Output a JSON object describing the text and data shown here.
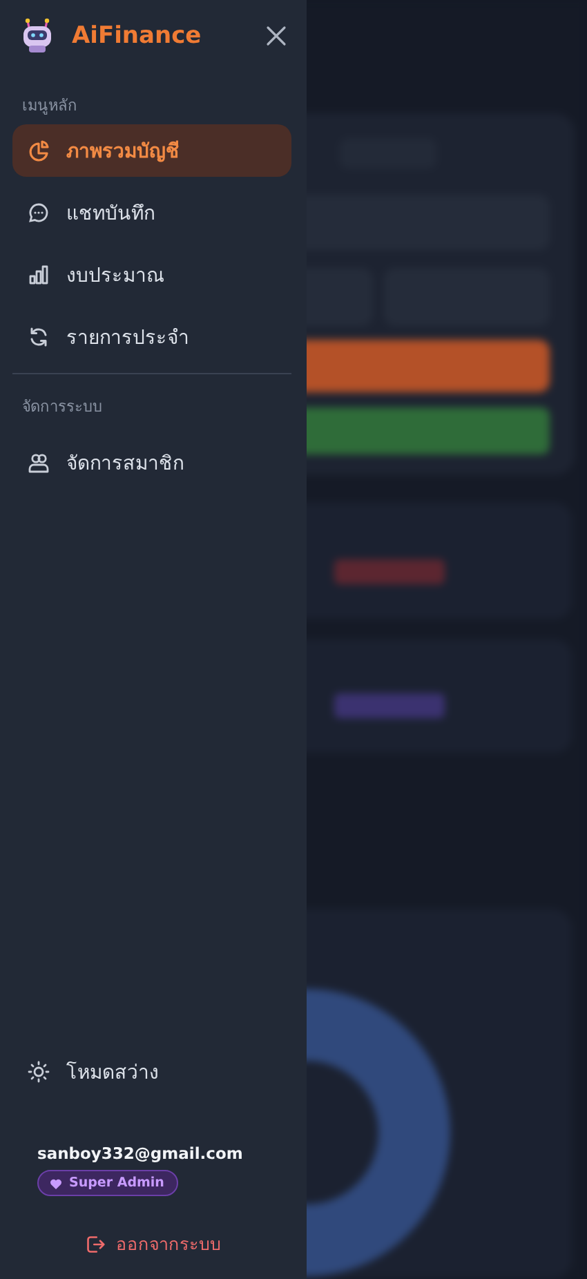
{
  "brand": {
    "name": "AiFinance"
  },
  "sections": [
    {
      "title": "เมนูหลัก",
      "items": [
        {
          "label": "ภาพรวมบัญชี",
          "kind": "pie",
          "selected": true
        },
        {
          "label": "แชทบันทึก",
          "kind": "chat",
          "selected": false
        },
        {
          "label": "งบประมาณ",
          "kind": "bars",
          "selected": false
        },
        {
          "label": "รายการประจำ",
          "kind": "repeat",
          "selected": false
        }
      ]
    },
    {
      "title": "จัดการระบบ",
      "items": [
        {
          "label": "จัดการสมาชิก",
          "kind": "users",
          "selected": false
        }
      ]
    }
  ],
  "theme_toggle": {
    "label": "โหมดสว่าง"
  },
  "user": {
    "email": "sanboy332@gmail.com",
    "role": "Super Admin"
  },
  "logout": {
    "label": "ออกจากระบบ"
  }
}
